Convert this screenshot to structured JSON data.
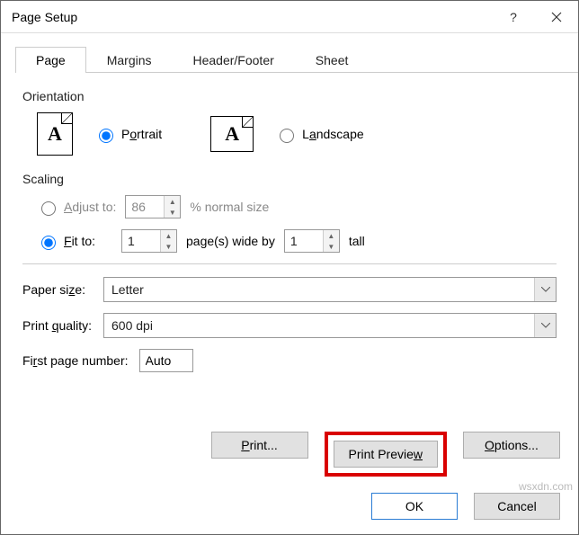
{
  "titlebar": {
    "title": "Page Setup"
  },
  "tabs": {
    "page": "Page",
    "margins": "Margins",
    "headerfooter": "Header/Footer",
    "sheet": "Sheet"
  },
  "orientation": {
    "label": "Orientation",
    "portrait": "Portrait",
    "landscape": "Landscape",
    "selected": "portrait"
  },
  "scaling": {
    "label": "Scaling",
    "adjust_to_label": "Adjust to:",
    "adjust_to_value": "86",
    "adjust_to_suffix": "% normal size",
    "fit_to_label": "Fit to:",
    "fit_to_wide": "1",
    "fit_to_mid": "page(s) wide by",
    "fit_to_tall": "1",
    "fit_to_suffix": "tall",
    "selected": "fit"
  },
  "paper_size": {
    "label": "Paper size:",
    "value": "Letter"
  },
  "print_quality": {
    "label": "Print quality:",
    "value": "600 dpi"
  },
  "first_page_number": {
    "label": "First page number:",
    "value": "Auto"
  },
  "buttons": {
    "print": "Print...",
    "print_preview": "Print Preview",
    "options": "Options...",
    "ok": "OK",
    "cancel": "Cancel"
  },
  "watermark": "wsxdn.com"
}
